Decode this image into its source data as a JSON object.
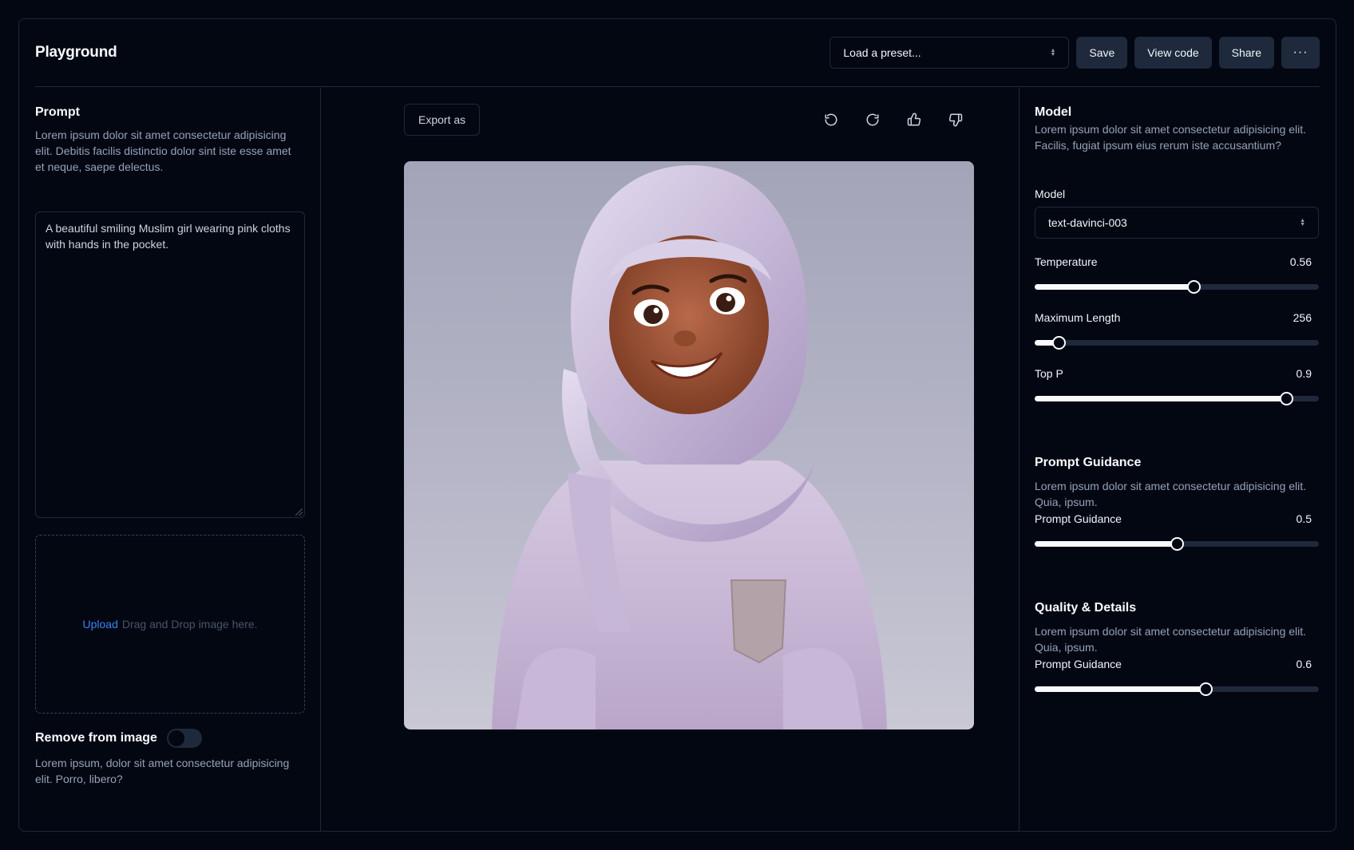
{
  "header": {
    "title": "Playground",
    "preset_placeholder": "Load a preset...",
    "save_label": "Save",
    "view_code_label": "View code",
    "share_label": "Share",
    "more_label": "···"
  },
  "left": {
    "prompt_title": "Prompt",
    "prompt_desc": "Lorem ipsum dolor sit amet consectetur adipisicing elit. Debitis facilis distinctio dolor sint iste esse amet et neque, saepe delectus.",
    "prompt_value": "A beautiful smiling Muslim girl wearing pink cloths with hands in the pocket.",
    "upload_link": "Upload",
    "upload_hint": "Drag and Drop image here.",
    "remove_label": "Remove from image",
    "remove_enabled": false,
    "remove_desc": "Lorem ipsum, dolor sit amet consectetur adipisicing elit. Porro, libero?"
  },
  "center": {
    "export_label": "Export as",
    "icons": [
      "undo-icon",
      "redo-icon",
      "thumbs-up-icon",
      "thumbs-down-icon"
    ],
    "image_alt": "3D cartoon girl in lavender hijab and sweater"
  },
  "right": {
    "model_title": "Model",
    "model_desc": "Lorem ipsum dolor sit amet consectetur adipisicing elit. Facilis, fugiat ipsum eius rerum iste accusantium?",
    "model_field_label": "Model",
    "model_value": "text-davinci-003",
    "sliders": [
      {
        "label": "Temperature",
        "value": "0.56",
        "fraction": 0.56
      },
      {
        "label": "Maximum Length",
        "value": "256",
        "fraction": 0.085
      },
      {
        "label": "Top P",
        "value": "0.9",
        "fraction": 0.885
      }
    ],
    "guidance_title": "Prompt Guidance",
    "guidance_desc": "Lorem ipsum dolor sit amet consectetur adipisicing elit. Quia, ipsum.",
    "guidance_slider": {
      "label": "Prompt Guidance",
      "value": "0.5",
      "fraction": 0.5
    },
    "quality_title": "Quality & Details",
    "quality_desc": "Lorem ipsum dolor sit amet consectetur adipisicing elit. Quia, ipsum.",
    "quality_slider": {
      "label": "Prompt Guidance",
      "value": "0.6",
      "fraction": 0.6
    }
  },
  "colors": {
    "background": "#030712",
    "border": "#1e293b",
    "muted_text": "#94a3b8",
    "link": "#3b82f6"
  }
}
